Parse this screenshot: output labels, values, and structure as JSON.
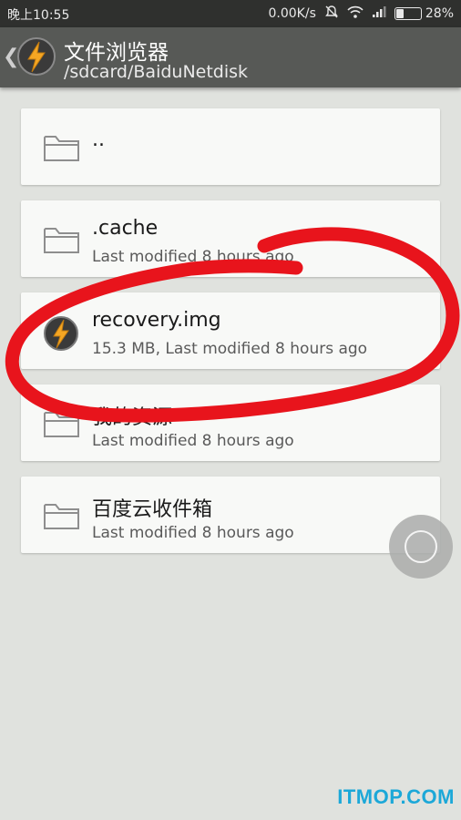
{
  "status_bar": {
    "time": "晚上10:55",
    "net_speed": "0.00K/s",
    "battery_percent": "28%",
    "battery_level": 0.28,
    "icons": [
      "mute-icon",
      "wifi-icon",
      "signal-icon",
      "battery-icon"
    ]
  },
  "app_bar": {
    "title": "文件浏览器",
    "path": "/sdcard/BaiduNetdisk"
  },
  "files": [
    {
      "name": "..",
      "meta": "",
      "icon": "folder-icon"
    },
    {
      "name": ".cache",
      "meta": "Last modified 8 hours ago",
      "icon": "folder-icon"
    },
    {
      "name": "recovery.img",
      "meta": "15.3 MB, Last modified 8 hours ago",
      "icon": "lightning-icon"
    },
    {
      "name": "我的资源",
      "meta": "Last modified 8 hours ago",
      "icon": "folder-icon"
    },
    {
      "name": "百度云收件箱",
      "meta": "Last modified 8 hours ago",
      "icon": "folder-icon"
    }
  ],
  "watermark": "ITMOP.COM",
  "colors": {
    "appbar": "#575956",
    "statusbar": "#2f302e",
    "background": "#e0e2de",
    "annotation": "#e8141c",
    "watermark": "#1ca8d8"
  }
}
